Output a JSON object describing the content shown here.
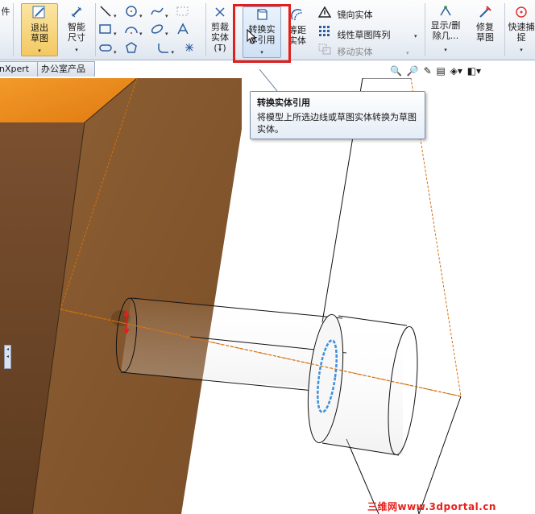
{
  "ribbon": {
    "cut_left_label": "件",
    "exit_sketch": "退出草图",
    "smart_dim": "智能尺寸",
    "trim": "剪裁实体(T)",
    "convert": "转换实体引用",
    "offset": "等距实体",
    "mirror": "镜向实体",
    "linear_pattern": "线性草图阵列",
    "move": "移动实体",
    "show_delete": "显示/删除几...",
    "repair": "修复草图",
    "quick_snap": "快速捕捉"
  },
  "tabs": [
    "nXpert",
    "办公室产品"
  ],
  "tooltip": {
    "title": "转换实体引用",
    "body": "将模型上所选边线或草图实体转换为草图实体。"
  },
  "watermark": "三维网www.3dportal.cn",
  "colors": {
    "highlight": "#e0201c",
    "face_top": "#f08c1c",
    "face_front": "#8a5a2e",
    "face_side": "#6b4422",
    "edge_selected": "#3b8fe0",
    "sketch_line": "#d4700c"
  }
}
